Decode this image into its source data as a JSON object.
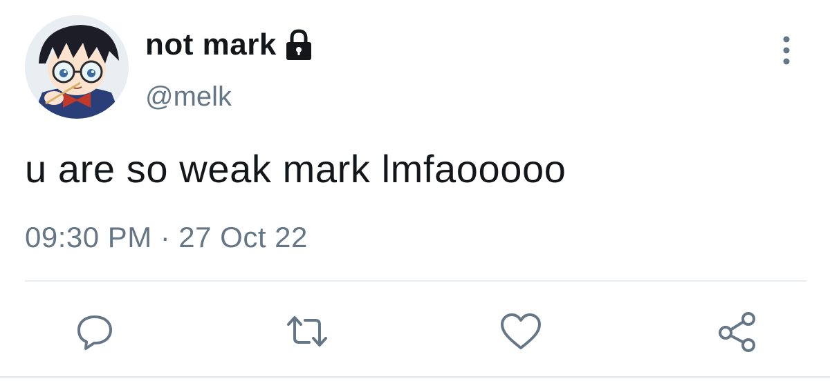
{
  "tweet": {
    "author": {
      "display_name": "not mark",
      "handle": "@melk",
      "protected_icon": "lock-icon",
      "avatar": "avatar-image"
    },
    "text": "u are so weak mark lmfaooooo",
    "time": "09:30 PM",
    "separator": "·",
    "date": "27 Oct 22",
    "menu_icon": "more-vertical-icon",
    "actions": [
      {
        "name": "reply",
        "icon": "reply-icon"
      },
      {
        "name": "retweet",
        "icon": "retweet-icon"
      },
      {
        "name": "like",
        "icon": "heart-icon"
      },
      {
        "name": "share",
        "icon": "share-icon"
      }
    ]
  },
  "colors": {
    "text_primary": "#14171a",
    "text_secondary": "#657786",
    "divider": "#e6ecf0"
  }
}
